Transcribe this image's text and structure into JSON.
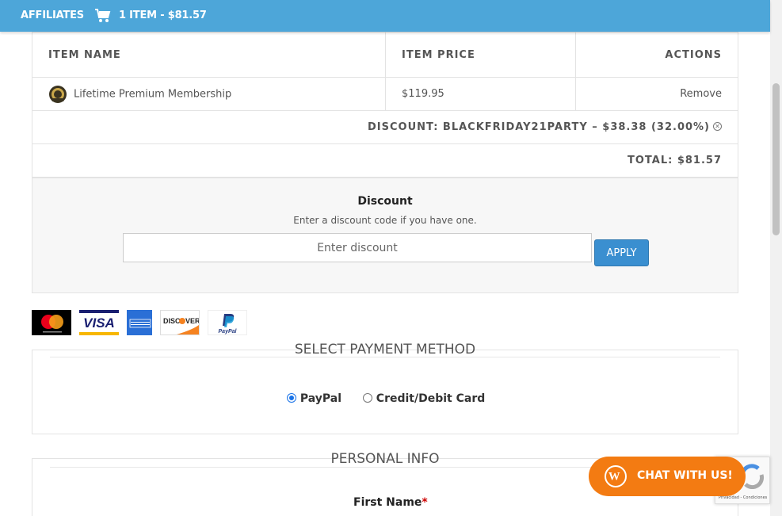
{
  "topbar": {
    "affiliates": "AFFILIATES",
    "cart_summary": "1 ITEM - $81.57"
  },
  "cart_table": {
    "headers": [
      "ITEM NAME",
      "ITEM PRICE",
      "ACTIONS"
    ],
    "row": {
      "name": "Lifetime Premium Membership",
      "price": "$119.95",
      "action": "Remove"
    },
    "discount_line": "DISCOUNT:  BLACKFRIDAY21PARTY – $38.38 (32.00%)",
    "total_line": "TOTAL: $81.57"
  },
  "discount": {
    "title": "Discount",
    "subtitle": "Enter a discount code if you have one.",
    "placeholder": "Enter discount",
    "apply": "APPLY"
  },
  "card_icons": [
    "mastercard-icon",
    "visa-icon",
    "amex-icon",
    "discover-icon",
    "paypal-icon"
  ],
  "payment": {
    "title": "SELECT PAYMENT METHOD",
    "options": [
      {
        "label": "PayPal",
        "selected": true
      },
      {
        "label": "Credit/Debit Card",
        "selected": false
      }
    ]
  },
  "personal": {
    "title": "PERSONAL INFO",
    "first_name": "First Name",
    "required_mark": "*"
  },
  "chat": {
    "label": "CHAT WITH US!"
  },
  "recaptcha": {
    "text": "Privacidad - Condiciones"
  },
  "colors": {
    "topbar": "#4da6d9",
    "apply": "#3a8fd0",
    "chat": "#f37b12"
  }
}
